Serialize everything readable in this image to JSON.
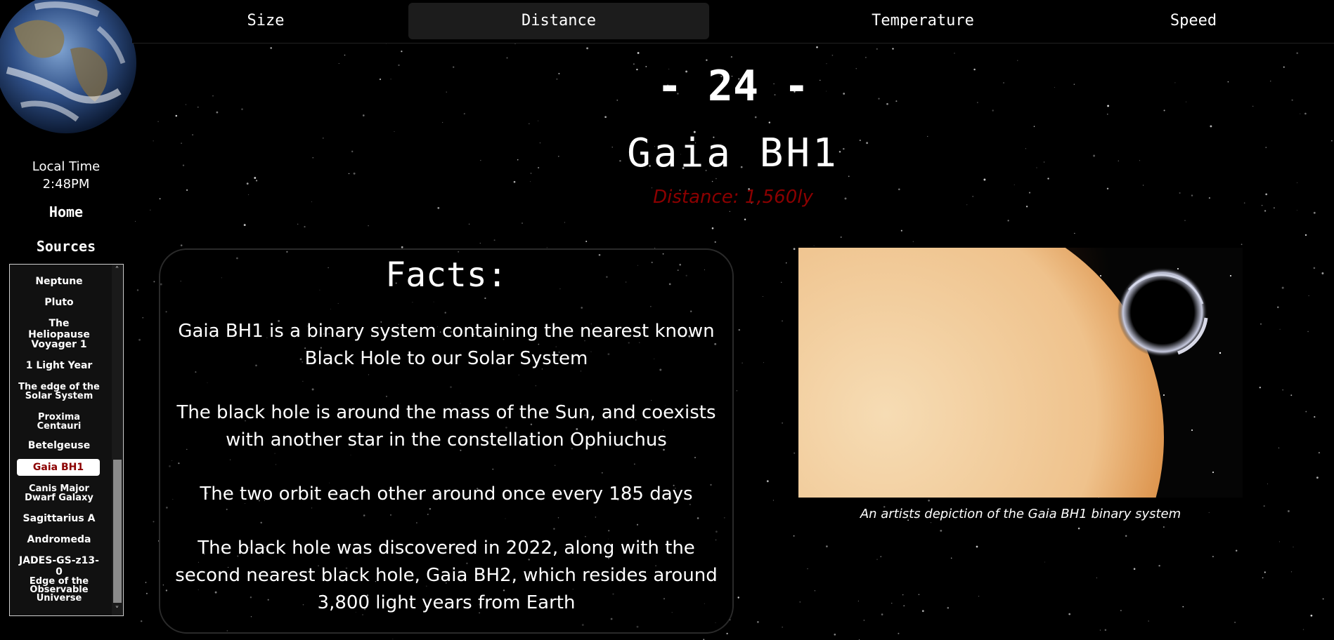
{
  "sidebar": {
    "local_time_label": "Local Time",
    "local_time_value": "2:48PM",
    "home_label": "Home",
    "sources_label": "Sources",
    "list_items": [
      {
        "label": "Neptune"
      },
      {
        "label": "Pluto"
      },
      {
        "label": "The Heliopause"
      },
      {
        "label": "Voyager 1"
      },
      {
        "label": "1 Light Year"
      },
      {
        "label": "The edge of the Solar System"
      },
      {
        "label": "Proxima Centauri"
      },
      {
        "label": "Betelgeuse"
      },
      {
        "label": "Gaia BH1",
        "selected": true
      },
      {
        "label": "Canis Major Dwarf Galaxy"
      },
      {
        "label": "Sagittarius A"
      },
      {
        "label": "Andromeda"
      },
      {
        "label": "JADES-GS-z13-0"
      },
      {
        "label": "Edge of the Observable Universe"
      }
    ],
    "scroll_up_icon": "chevron-up-icon",
    "scroll_down_icon": "chevron-down-icon"
  },
  "tabs": [
    {
      "label": "Size",
      "active": false
    },
    {
      "label": "Distance",
      "active": true
    },
    {
      "label": "Temperature",
      "active": false
    },
    {
      "label": "Speed",
      "active": false
    }
  ],
  "header": {
    "rank": "- 24 -",
    "object_name": "Gaia BH1",
    "distance": "Distance: 1,560ly"
  },
  "facts": {
    "title": "Facts:",
    "items": [
      "Gaia BH1 is a binary system containing the nearest known Black Hole to our Solar System",
      "The black hole is around the mass of the Sun, and coexists with another star in the constellation Ophiuchus",
      "The two orbit each other around once every 185 days",
      "The black hole was discovered in 2022, along with the second nearest black hole, Gaia BH2, which resides around 3,800 light years from Earth"
    ]
  },
  "image": {
    "caption": "An artists depiction of the Gaia BH1 binary system"
  },
  "colors": {
    "accent_red": "#8b0000",
    "background": "#000000",
    "active_tab": "#1c1c1c"
  }
}
